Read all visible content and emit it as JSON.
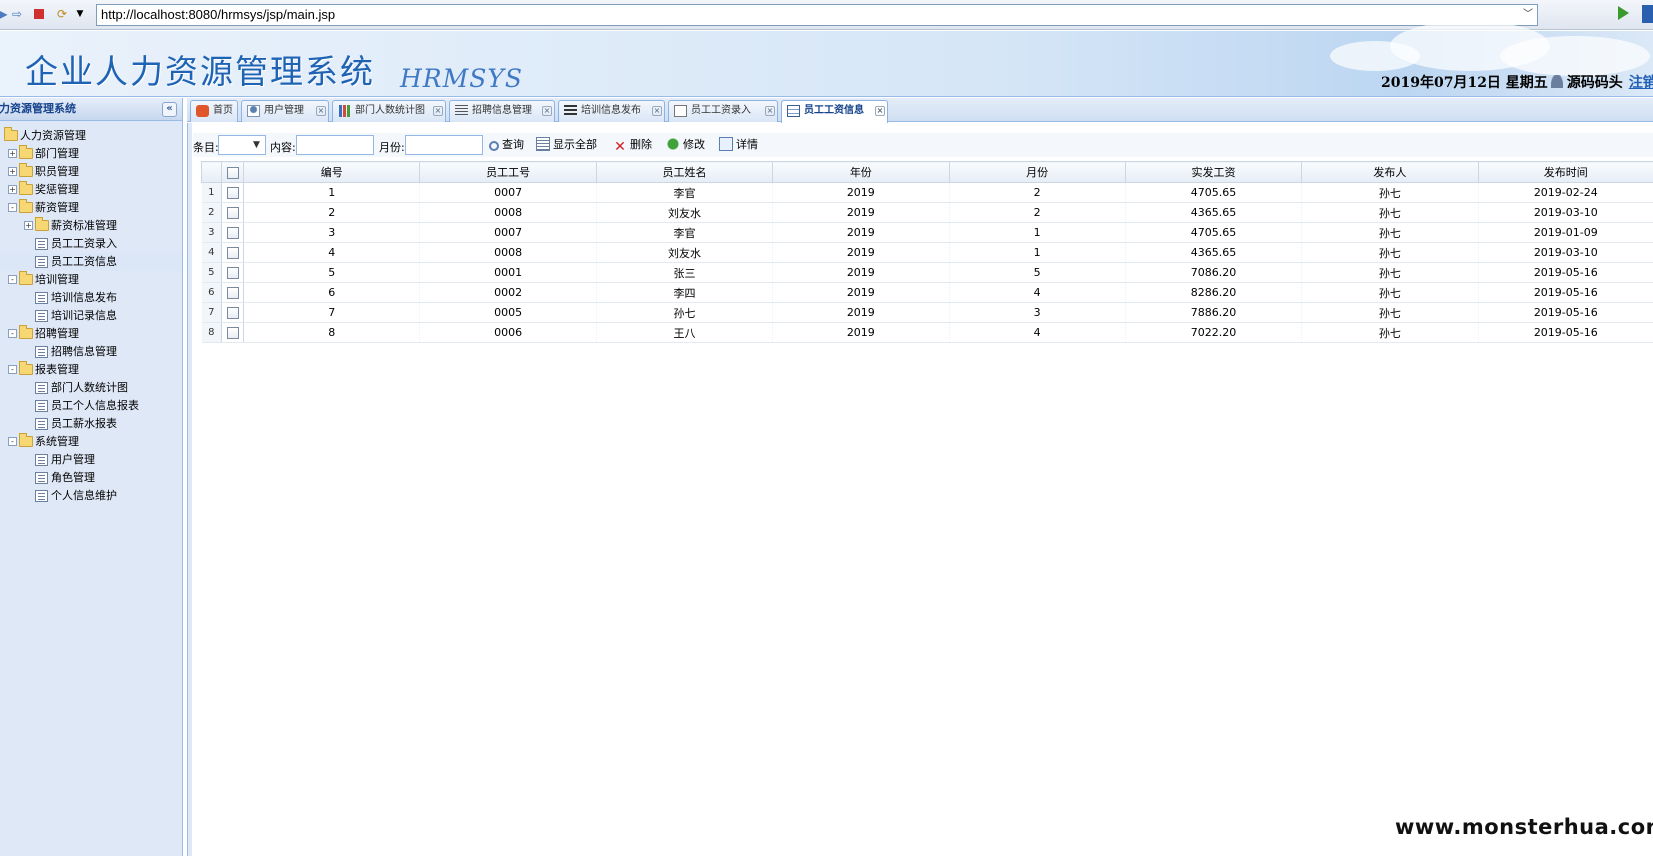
{
  "browser": {
    "url": "http://localhost:8080/hrmsys/jsp/main.jsp"
  },
  "header": {
    "title": "企业人力资源管理系统",
    "subtitle": "HRMSYS",
    "date": "2019年07月12日 星期五",
    "username": "源码码头",
    "logout_label": "注销"
  },
  "sidebar": {
    "title": "人力资源管理系统",
    "collapse_label": "«",
    "items": [
      {
        "label": "人力资源管理",
        "level": 0,
        "type": "folder",
        "expander": ""
      },
      {
        "label": "部门管理",
        "level": 1,
        "type": "folder",
        "expander": "+"
      },
      {
        "label": "职员管理",
        "level": 1,
        "type": "folder",
        "expander": "+"
      },
      {
        "label": "奖惩管理",
        "level": 1,
        "type": "folder",
        "expander": "+"
      },
      {
        "label": "薪资管理",
        "level": 1,
        "type": "folder",
        "expander": "-"
      },
      {
        "label": "薪资标准管理",
        "level": 2,
        "type": "folder",
        "expander": "+"
      },
      {
        "label": "员工工资录入",
        "level": 2,
        "type": "leaf",
        "expander": ""
      },
      {
        "label": "员工工资信息",
        "level": 2,
        "type": "leaf",
        "expander": "",
        "selected": true
      },
      {
        "label": "培训管理",
        "level": 1,
        "type": "folder",
        "expander": "-"
      },
      {
        "label": "培训信息发布",
        "level": 2,
        "type": "leaf",
        "expander": ""
      },
      {
        "label": "培训记录信息",
        "level": 2,
        "type": "leaf",
        "expander": ""
      },
      {
        "label": "招聘管理",
        "level": 1,
        "type": "folder",
        "expander": "-"
      },
      {
        "label": "招聘信息管理",
        "level": 2,
        "type": "leaf",
        "expander": ""
      },
      {
        "label": "报表管理",
        "level": 1,
        "type": "folder",
        "expander": "-"
      },
      {
        "label": "部门人数统计图",
        "level": 2,
        "type": "leaf",
        "expander": ""
      },
      {
        "label": "员工个人信息报表",
        "level": 2,
        "type": "leaf",
        "expander": ""
      },
      {
        "label": "员工薪水报表",
        "level": 2,
        "type": "leaf",
        "expander": ""
      },
      {
        "label": "系统管理",
        "level": 1,
        "type": "folder",
        "expander": "-"
      },
      {
        "label": "用户管理",
        "level": 2,
        "type": "leaf",
        "expander": ""
      },
      {
        "label": "角色管理",
        "level": 2,
        "type": "leaf",
        "expander": ""
      },
      {
        "label": "个人信息维护",
        "level": 2,
        "type": "leaf",
        "expander": ""
      }
    ]
  },
  "tabs": [
    {
      "label": "首页",
      "icon": "home-icon",
      "closable": false
    },
    {
      "label": "用户管理",
      "icon": "user-icon",
      "closable": true
    },
    {
      "label": "部门人数统计图",
      "icon": "chart-icon",
      "closable": true
    },
    {
      "label": "招聘信息管理",
      "icon": "list-icon",
      "closable": true
    },
    {
      "label": "培训信息发布",
      "icon": "lines-icon",
      "closable": true
    },
    {
      "label": "员工工资录入",
      "icon": "edit-icon",
      "closable": true
    },
    {
      "label": "员工工资信息",
      "icon": "table-icon",
      "closable": true,
      "active": true
    }
  ],
  "toolbar": {
    "condition_label": "条目:",
    "content_label": "内容:",
    "month_label": "月份:",
    "search_label": "查询",
    "show_all_label": "显示全部",
    "delete_label": "删除",
    "edit_label": "修改",
    "detail_label": "详情"
  },
  "grid": {
    "columns": [
      "编号",
      "员工工号",
      "员工姓名",
      "年份",
      "月份",
      "实发工资",
      "发布人",
      "发布时间"
    ],
    "rows": [
      [
        "1",
        "0007",
        "李官",
        "2019",
        "2",
        "4705.65",
        "孙七",
        "2019-02-24"
      ],
      [
        "2",
        "0008",
        "刘友水",
        "2019",
        "2",
        "4365.65",
        "孙七",
        "2019-03-10"
      ],
      [
        "3",
        "0007",
        "李官",
        "2019",
        "1",
        "4705.65",
        "孙七",
        "2019-01-09"
      ],
      [
        "4",
        "0008",
        "刘友水",
        "2019",
        "1",
        "4365.65",
        "孙七",
        "2019-03-10"
      ],
      [
        "5",
        "0001",
        "张三",
        "2019",
        "5",
        "7086.20",
        "孙七",
        "2019-05-16"
      ],
      [
        "6",
        "0002",
        "李四",
        "2019",
        "4",
        "8286.20",
        "孙七",
        "2019-05-16"
      ],
      [
        "7",
        "0005",
        "孙七",
        "2019",
        "3",
        "7886.20",
        "孙七",
        "2019-05-16"
      ],
      [
        "8",
        "0006",
        "王八",
        "2019",
        "4",
        "7022.20",
        "孙七",
        "2019-05-16"
      ]
    ]
  },
  "watermark": "www.monsterhua.com"
}
